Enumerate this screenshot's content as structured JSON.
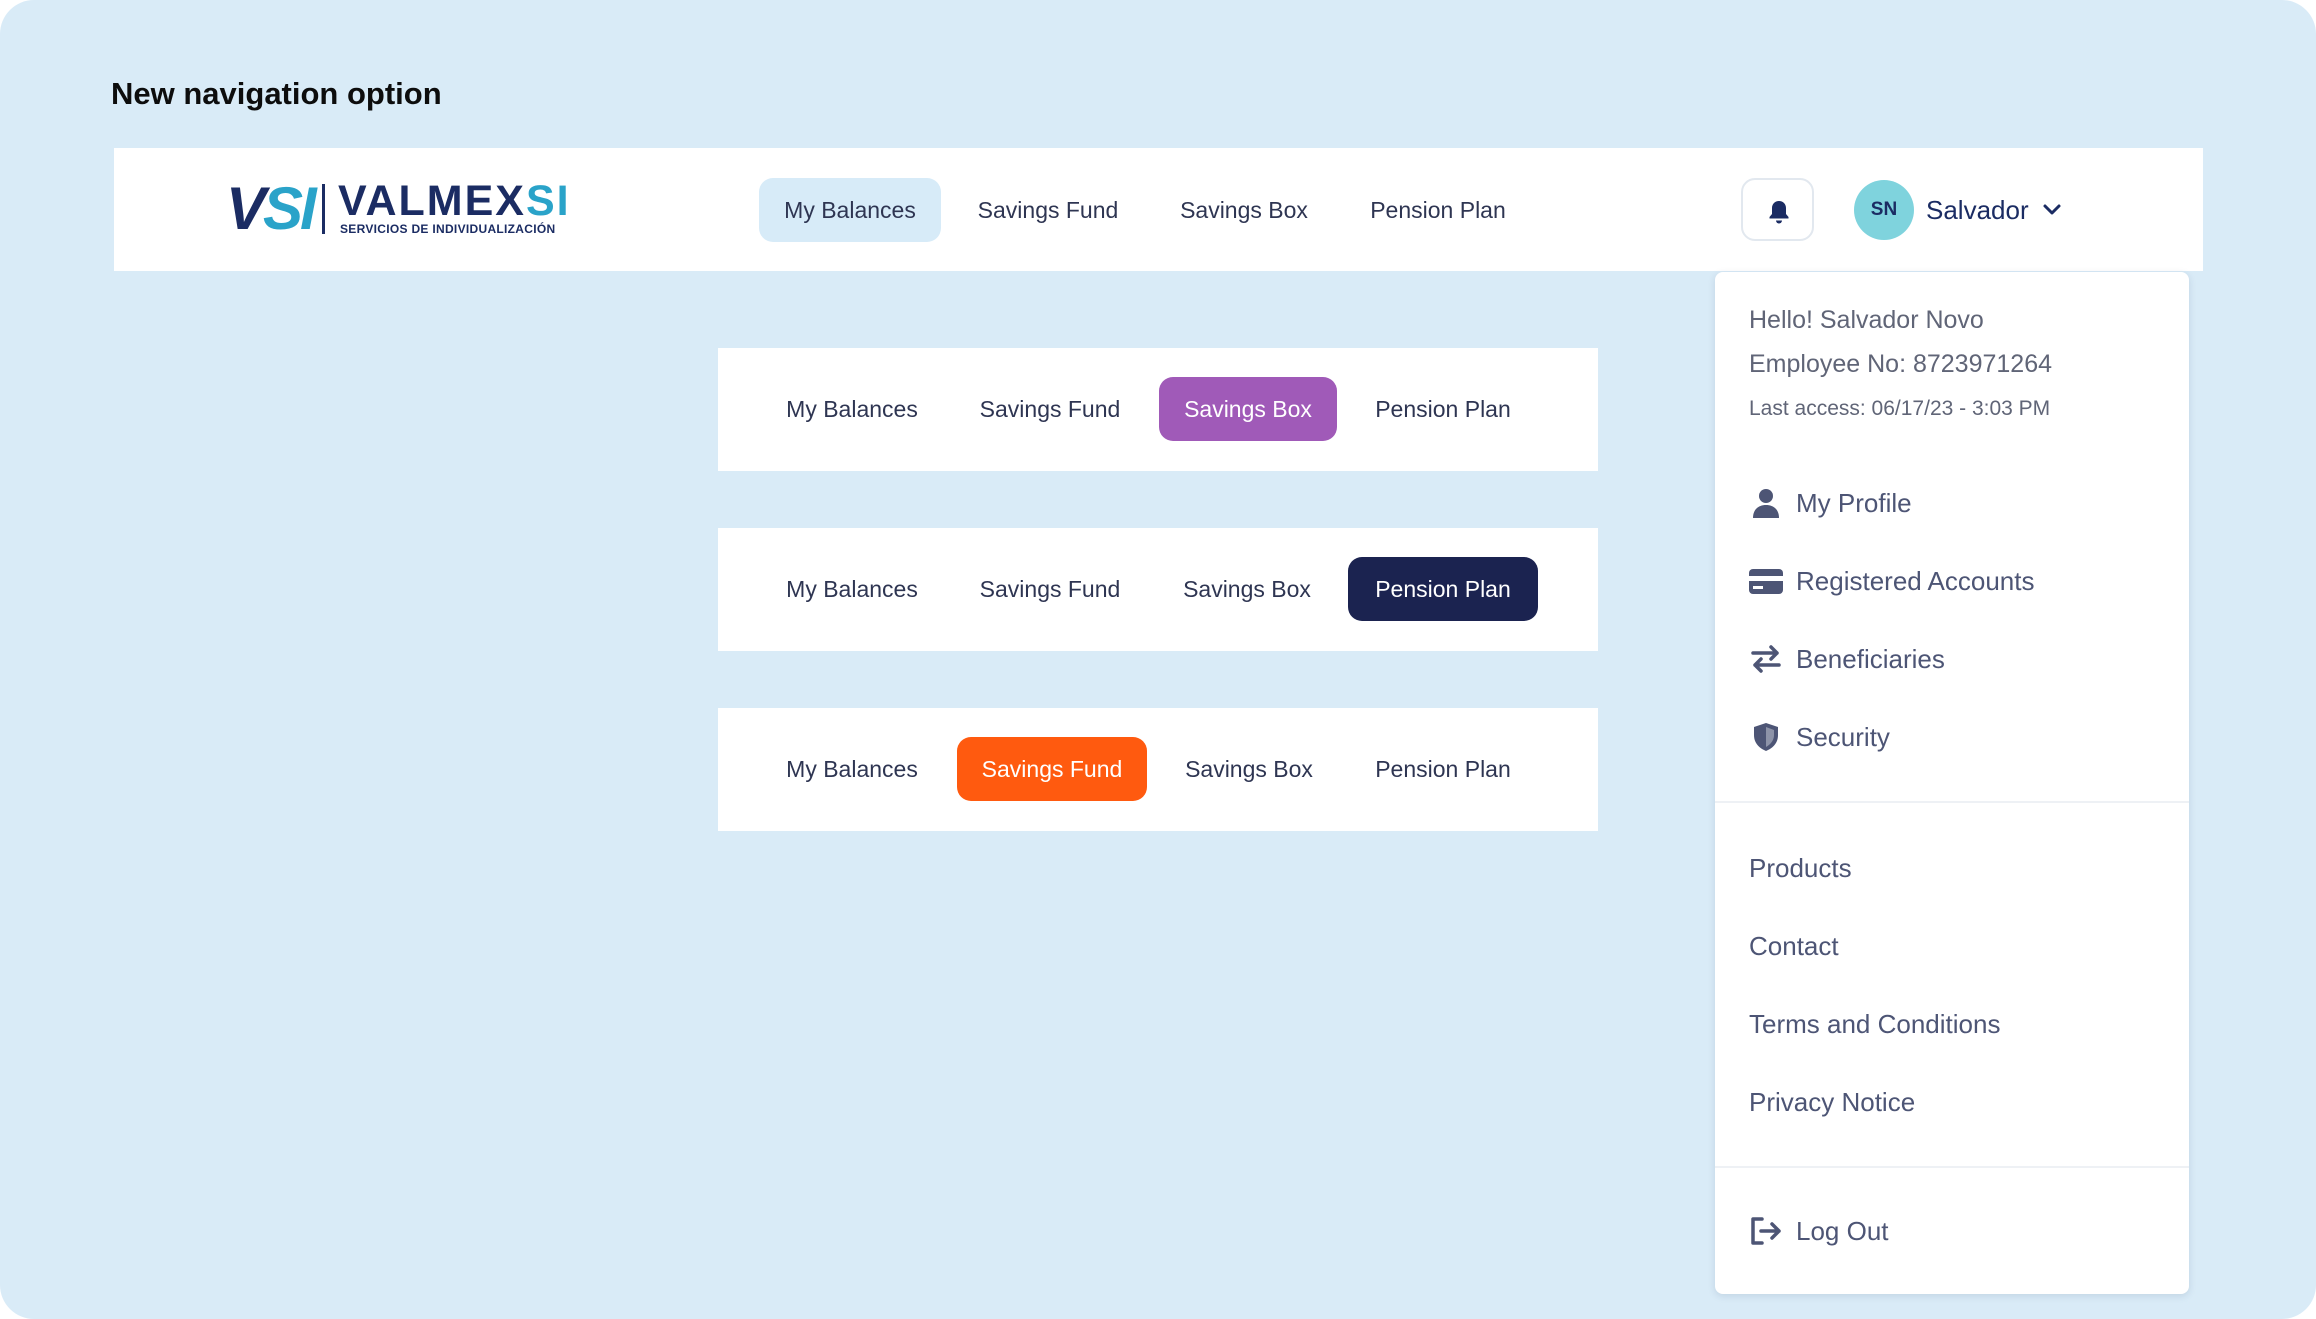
{
  "page": {
    "heading": "New navigation option"
  },
  "brand": {
    "logo_mark_v": "V",
    "logo_mark_si": "SI",
    "logo_name_main": "VALMEX",
    "logo_name_si": "SI",
    "logo_tagline": "SERVICIOS DE INDIVIDUALIZACIÓN",
    "colors": {
      "navy": "#1b2c63",
      "teal": "#2aa3c9"
    }
  },
  "topbar": {
    "nav": [
      {
        "label": "My Balances",
        "active": true
      },
      {
        "label": "Savings Fund",
        "active": false
      },
      {
        "label": "Savings Box",
        "active": false
      },
      {
        "label": "Pension Plan",
        "active": false
      }
    ],
    "active_style": {
      "background": "#d7ebf8",
      "text": "#2e3552"
    },
    "notification_icon": "bell-icon",
    "user": {
      "initials": "SN",
      "name": "Salvador",
      "dropdown_icon": "chevron-down-icon"
    }
  },
  "variants": [
    {
      "items": [
        "My Balances",
        "Savings Fund",
        "Savings Box",
        "Pension Plan"
      ],
      "active_index": 2,
      "active_bg": "#a05ab8"
    },
    {
      "items": [
        "My Balances",
        "Savings Fund",
        "Savings Box",
        "Pension Plan"
      ],
      "active_index": 3,
      "active_bg": "#1b2350"
    },
    {
      "items": [
        "My Balances",
        "Savings Fund",
        "Savings Box",
        "Pension Plan"
      ],
      "active_index": 1,
      "active_bg": "#ff5a0f"
    }
  ],
  "user_menu": {
    "greeting": "Hello! Salvador Novo",
    "employee": "Employee No: 8723971264",
    "last_access": "Last access: 06/17/23 - 3:03 PM",
    "account_items": [
      {
        "label": "My Profile",
        "icon": "person-icon"
      },
      {
        "label": "Registered Accounts",
        "icon": "credit-card-icon"
      },
      {
        "label": "Beneficiaries",
        "icon": "swap-arrows-icon"
      },
      {
        "label": "Security",
        "icon": "shield-icon"
      }
    ],
    "info_items": [
      {
        "label": "Products"
      },
      {
        "label": "Contact"
      },
      {
        "label": "Terms and Conditions"
      },
      {
        "label": "Privacy Notice"
      }
    ],
    "logout": {
      "label": "Log Out",
      "icon": "logout-icon"
    }
  }
}
